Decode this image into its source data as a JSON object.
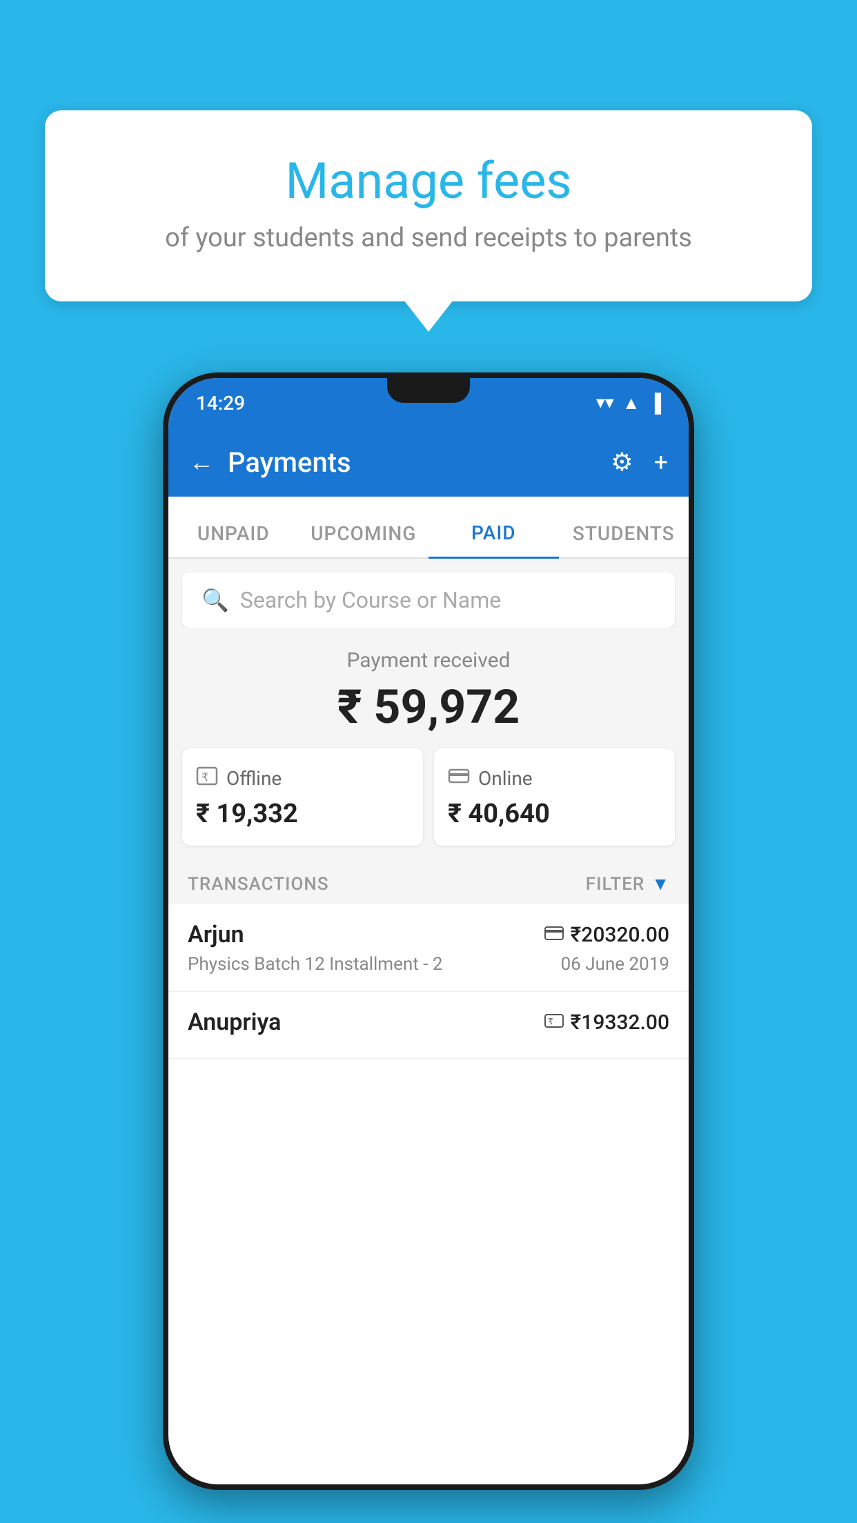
{
  "background_color": "#29b6e8",
  "bubble": {
    "title": "Manage fees",
    "subtitle": "of your students and send receipts to parents"
  },
  "status_bar": {
    "time": "14:29",
    "wifi": "▼",
    "signal": "▲",
    "battery": "▐"
  },
  "header": {
    "title": "Payments",
    "back_label": "←",
    "gear_label": "⚙",
    "plus_label": "+"
  },
  "tabs": [
    {
      "label": "UNPAID",
      "active": false
    },
    {
      "label": "UPCOMING",
      "active": false
    },
    {
      "label": "PAID",
      "active": true
    },
    {
      "label": "STUDENTS",
      "active": false
    }
  ],
  "search": {
    "placeholder": "Search by Course or Name"
  },
  "payment": {
    "label": "Payment received",
    "amount": "₹ 59,972"
  },
  "cards": [
    {
      "type": "Offline",
      "amount": "₹ 19,332",
      "icon": "rupee-offline"
    },
    {
      "type": "Online",
      "amount": "₹ 40,640",
      "icon": "card-online"
    }
  ],
  "transactions_label": "TRANSACTIONS",
  "filter_label": "FILTER",
  "transactions": [
    {
      "name": "Arjun",
      "amount": "₹20320.00",
      "course": "Physics Batch 12 Installment - 2",
      "date": "06 June 2019",
      "payment_type": "online"
    },
    {
      "name": "Anupriya",
      "amount": "₹19332.00",
      "course": "",
      "date": "",
      "payment_type": "offline"
    }
  ]
}
